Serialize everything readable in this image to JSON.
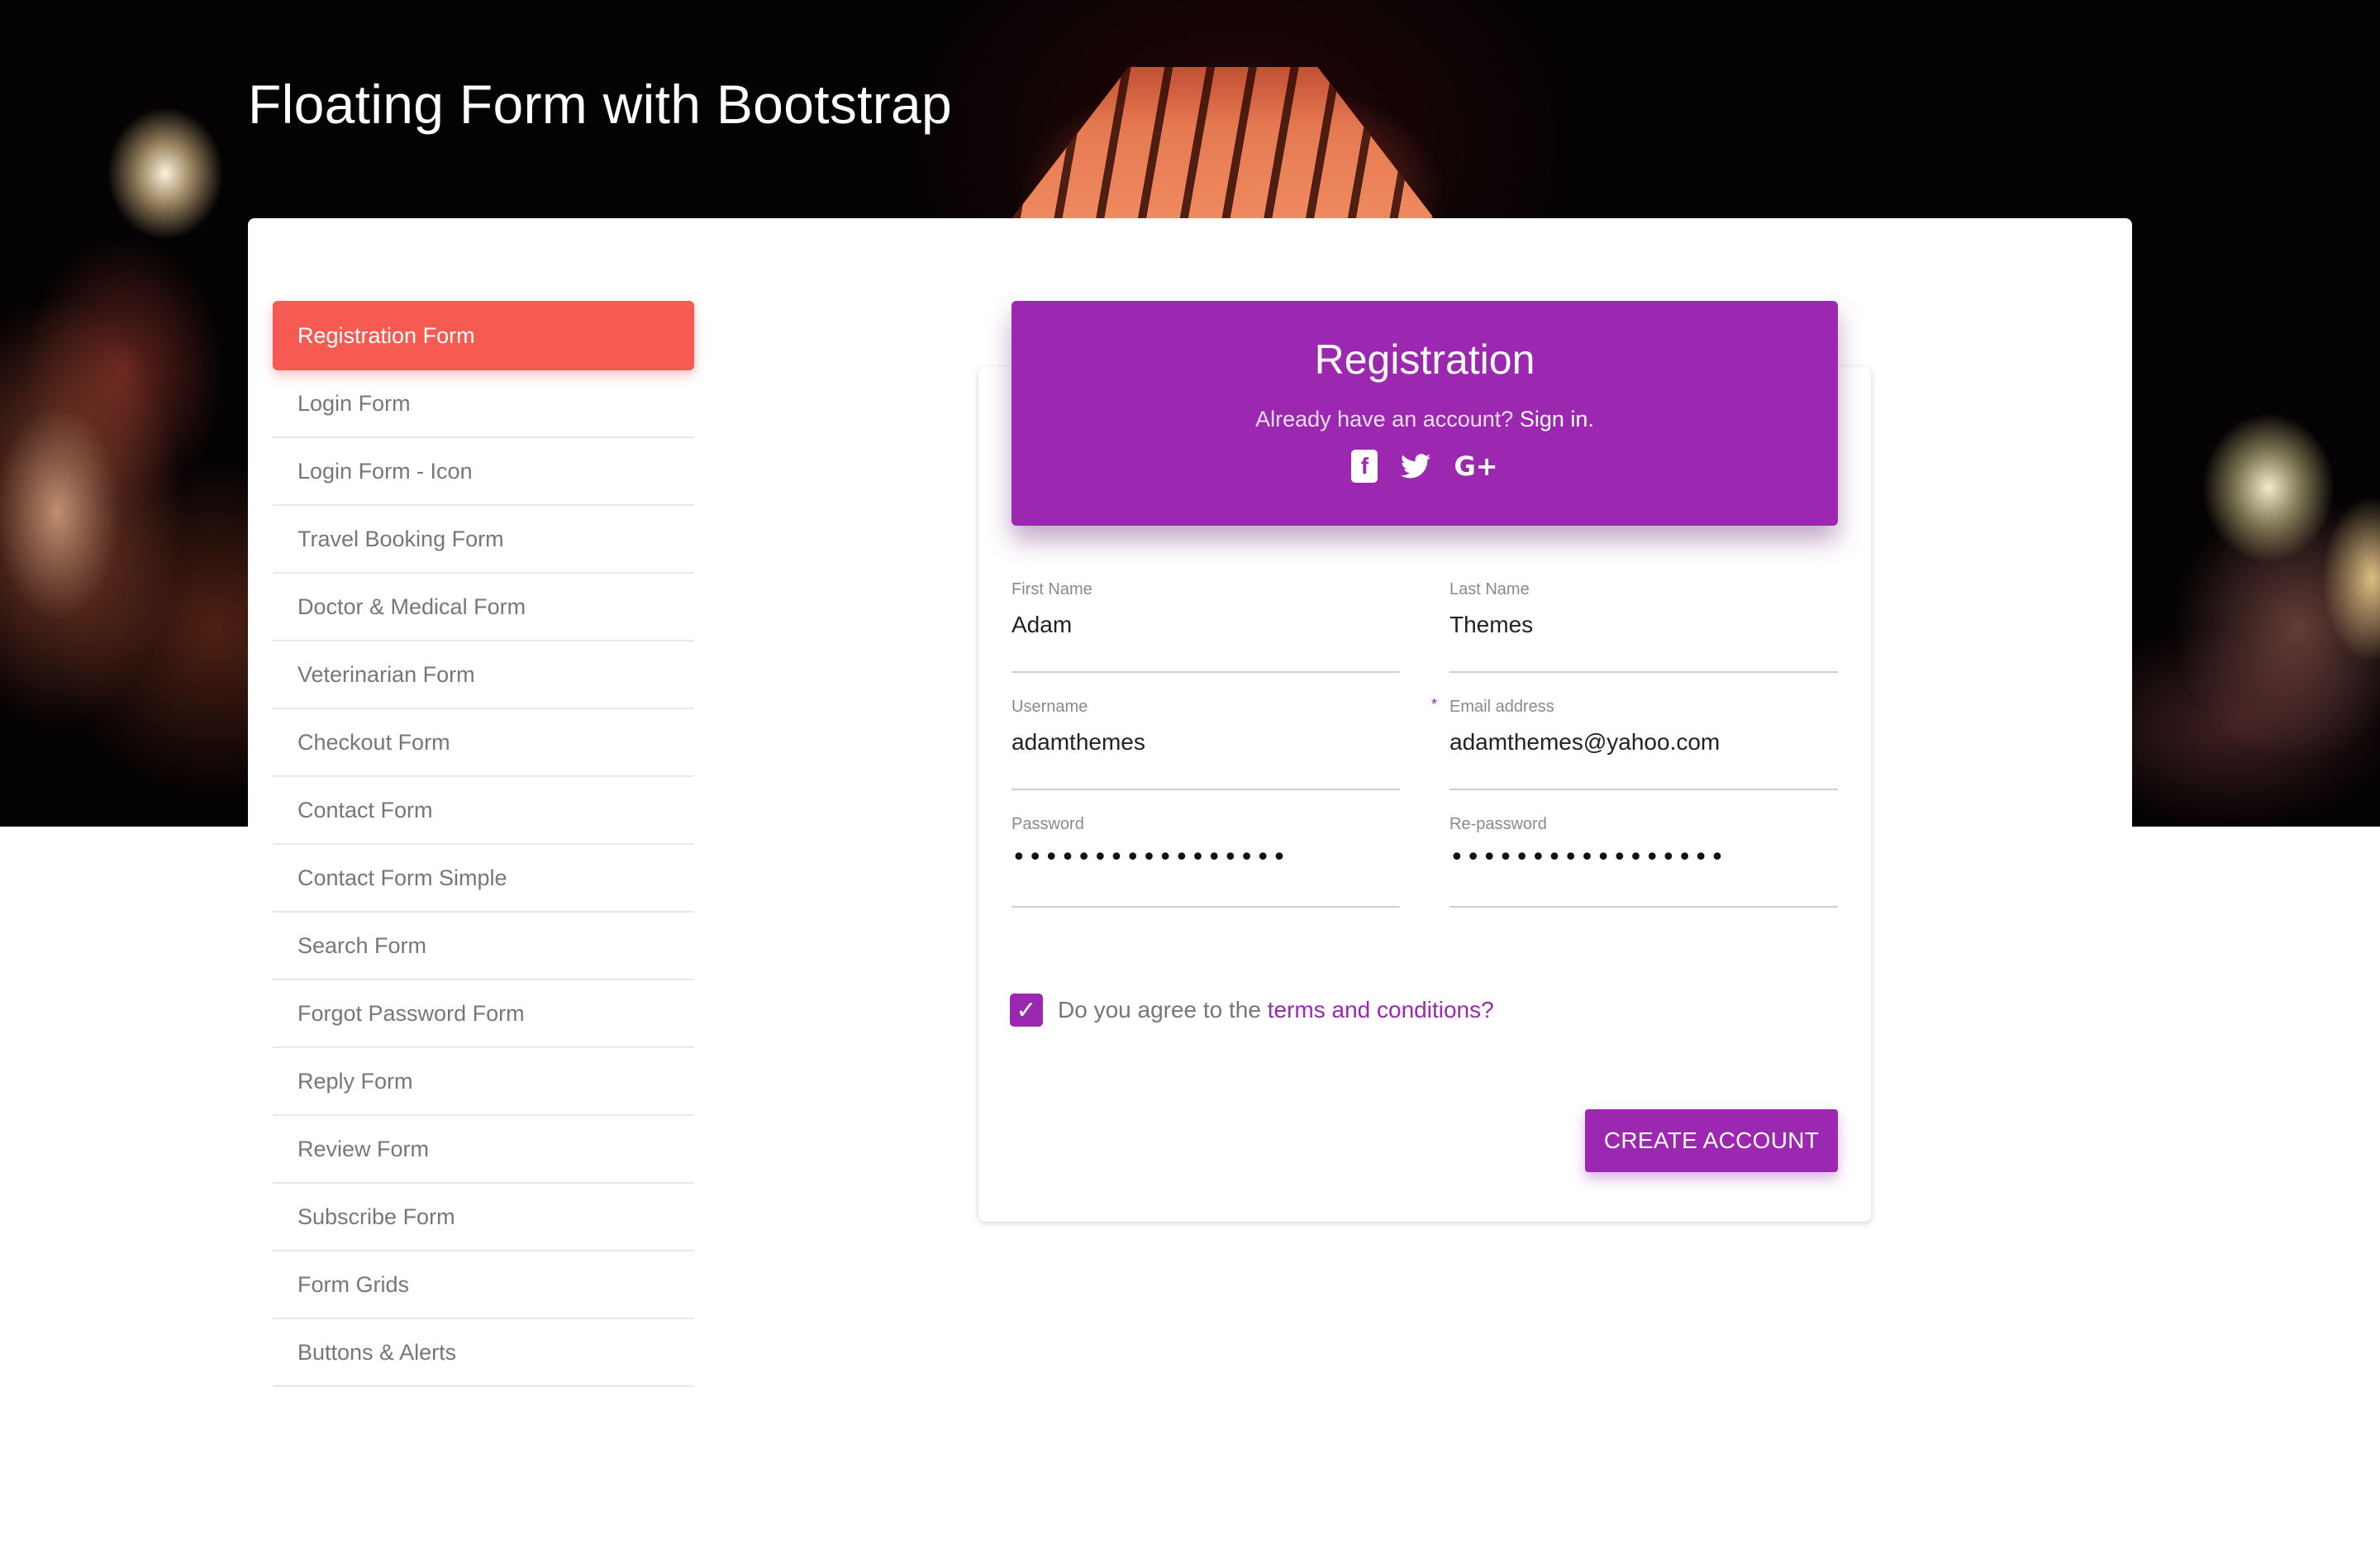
{
  "page": {
    "title": "Floating Form with Bootstrap"
  },
  "sidebar": {
    "items": [
      {
        "label": "Registration Form",
        "active": true
      },
      {
        "label": "Login Form"
      },
      {
        "label": "Login Form - Icon"
      },
      {
        "label": "Travel Booking Form"
      },
      {
        "label": "Doctor & Medical Form"
      },
      {
        "label": "Veterinarian Form"
      },
      {
        "label": "Checkout Form"
      },
      {
        "label": "Contact Form"
      },
      {
        "label": "Contact Form Simple"
      },
      {
        "label": "Search Form"
      },
      {
        "label": "Forgot Password Form"
      },
      {
        "label": "Reply Form"
      },
      {
        "label": "Review Form"
      },
      {
        "label": "Subscribe Form"
      },
      {
        "label": "Form Grids"
      },
      {
        "label": "Buttons & Alerts"
      }
    ]
  },
  "form": {
    "heading": "Registration",
    "signin_prompt": "Already have an account?",
    "signin_link": "Sign in.",
    "socials": [
      "facebook-icon",
      "twitter-icon",
      "google-plus-icon"
    ],
    "fields": {
      "first_name": {
        "label": "First Name",
        "value": "Adam"
      },
      "last_name": {
        "label": "Last Name",
        "value": "Themes"
      },
      "username": {
        "label": "Username",
        "value": "adamthemes"
      },
      "email": {
        "label": "Email address",
        "value": "adamthemes@yahoo.com",
        "required_marker": "*"
      },
      "password": {
        "label": "Password",
        "value": "•••••••••••••••••"
      },
      "repassword": {
        "label": "Re-password",
        "value": "•••••••••••••••••"
      }
    },
    "agree_text": "Do you agree to the",
    "terms_link": "terms and conditions?",
    "agree_checked": true,
    "submit_label": "CREATE ACCOUNT"
  },
  "colors": {
    "accent": "#9c27b0",
    "active_nav": "#f65a50"
  }
}
